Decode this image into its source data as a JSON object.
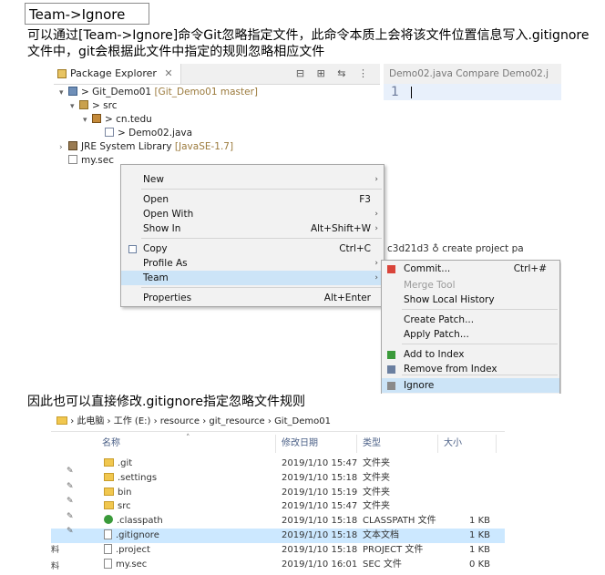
{
  "heading": "Team->Ignore",
  "intro_text": "可以通过[Team->Ignore]命令Git忽略指定文件，此命令本质上会将该文件位置信息写入.gitignore文件中，git会根据此文件中指定的规则忽略相应文件",
  "eclipse": {
    "package_explorer_tab": "Package Explorer",
    "tab_close": "✕",
    "toolbar_glyphs": "⊟ ⊞ ⇆ ⋮",
    "tree": [
      {
        "arrow": "▾",
        "prefix": "> ",
        "name": "Git_Demo01",
        "decoration": "[Git_Demo01 master]",
        "icon": "project-icon"
      },
      {
        "arrow": "▾",
        "prefix": "> ",
        "name": "src",
        "decoration": "",
        "icon": "source-folder-icon"
      },
      {
        "arrow": "▾",
        "prefix": "> ",
        "name": "cn.tedu",
        "decoration": "",
        "icon": "package-icon"
      },
      {
        "arrow": "",
        "prefix": "> ",
        "name": "Demo02.java",
        "decoration": "",
        "icon": "java-file-icon"
      },
      {
        "arrow": "›",
        "prefix": "",
        "name": "JRE System Library",
        "decoration": "[JavaSE-1.7]",
        "icon": "library-icon"
      },
      {
        "arrow": "",
        "prefix": "",
        "name": "my.sec",
        "decoration": "",
        "icon": "file-icon"
      }
    ],
    "editor_tabs": "Demo02.java    Compare Demo02.j",
    "line_number": "1",
    "history_row": "c3d21d3 ♁     create project                    pa",
    "context_menu": [
      {
        "label": "New",
        "shortcut": "",
        "submenu": true
      },
      {
        "label": "Open",
        "shortcut": "F3",
        "submenu": false
      },
      {
        "label": "Open With",
        "shortcut": "",
        "submenu": true
      },
      {
        "label": "Show In",
        "shortcut": "Alt+Shift+W",
        "submenu": true
      },
      {
        "label": "Copy",
        "shortcut": "Ctrl+C",
        "submenu": false
      },
      {
        "label": "Profile As",
        "shortcut": "",
        "submenu": true
      },
      {
        "label": "Team",
        "shortcut": "",
        "submenu": true
      },
      {
        "label": "Properties",
        "shortcut": "Alt+Enter",
        "submenu": false
      }
    ],
    "team_submenu": [
      {
        "label": "Commit...",
        "shortcut": "Ctrl+#",
        "disabled": false
      },
      {
        "label": "Merge Tool",
        "shortcut": "",
        "disabled": true
      },
      {
        "label": "Show Local History",
        "shortcut": "",
        "disabled": false
      },
      {
        "label": "Create Patch...",
        "shortcut": "",
        "disabled": false
      },
      {
        "label": "Apply Patch...",
        "shortcut": "",
        "disabled": false
      },
      {
        "label": "Add to Index",
        "shortcut": "",
        "disabled": false
      },
      {
        "label": "Remove from Index",
        "shortcut": "",
        "disabled": false
      },
      {
        "label": "Ignore",
        "shortcut": "",
        "disabled": false
      }
    ]
  },
  "outro_text": "因此也可以直接修改.gitignore指定忽略文件规则",
  "explorer": {
    "breadcrumb": [
      "此电脑",
      "工作 (E:)",
      "resource",
      "git_resource",
      "Git_Demo01"
    ],
    "columns": {
      "name": "名称",
      "date": "修改日期",
      "type": "类型",
      "size": "大小"
    },
    "files": [
      {
        "name": ".git",
        "date": "2019/1/10 15:47",
        "type": "文件夹",
        "size": "",
        "kind": "folder"
      },
      {
        "name": ".settings",
        "date": "2019/1/10 15:18",
        "type": "文件夹",
        "size": "",
        "kind": "folder"
      },
      {
        "name": "bin",
        "date": "2019/1/10 15:19",
        "type": "文件夹",
        "size": "",
        "kind": "folder"
      },
      {
        "name": "src",
        "date": "2019/1/10 15:47",
        "type": "文件夹",
        "size": "",
        "kind": "folder"
      },
      {
        "name": ".classpath",
        "date": "2019/1/10 15:18",
        "type": "CLASSPATH 文件",
        "size": "1 KB",
        "kind": "classpath"
      },
      {
        "name": ".gitignore",
        "date": "2019/1/10 15:18",
        "type": "文本文档",
        "size": "1 KB",
        "kind": "file"
      },
      {
        "name": ".project",
        "date": "2019/1/10 15:18",
        "type": "PROJECT 文件",
        "size": "1 KB",
        "kind": "file"
      },
      {
        "name": "my.sec",
        "date": "2019/1/10 16:01",
        "type": "SEC 文件",
        "size": "0 KB",
        "kind": "file"
      }
    ],
    "selected_file": ".gitignore",
    "left_labels": [
      "料",
      "料"
    ]
  }
}
